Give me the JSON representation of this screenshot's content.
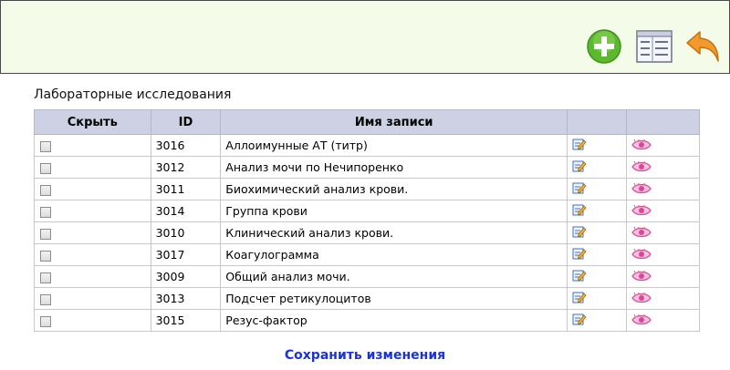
{
  "toolbar": {
    "add_icon": "add-circle-icon",
    "list_icon": "list-view-icon",
    "back_icon": "undo-arrow-icon",
    "colors": {
      "background": "#f5fbe9",
      "add": "#5cb82e",
      "back": "#f29a2e"
    }
  },
  "section": {
    "title": "Лабораторные исследования"
  },
  "table": {
    "columns": {
      "hide": "Скрыть",
      "id": "ID",
      "name": "Имя записи",
      "edit": "",
      "view": ""
    },
    "header_color": "#cdd1e3",
    "rows": [
      {
        "checked": false,
        "id": "3016",
        "name": "Аллоимунные АТ (титр)"
      },
      {
        "checked": false,
        "id": "3012",
        "name": "Анализ мочи по Нечипоренко"
      },
      {
        "checked": false,
        "id": "3011",
        "name": "Биохимический анализ крови."
      },
      {
        "checked": false,
        "id": "3014",
        "name": "Группа крови"
      },
      {
        "checked": false,
        "id": "3010",
        "name": "Клинический анализ крови."
      },
      {
        "checked": false,
        "id": "3017",
        "name": "Коагулограмма"
      },
      {
        "checked": false,
        "id": "3009",
        "name": "Общий анализ мочи."
      },
      {
        "checked": false,
        "id": "3013",
        "name": "Подсчет ретикулоцитов"
      },
      {
        "checked": false,
        "id": "3015",
        "name": "Резус-фактор"
      }
    ],
    "row_icons": {
      "edit": "edit-pencil-icon",
      "view": "eye-icon"
    }
  },
  "actions": {
    "save_label": "Сохранить изменения",
    "link_color": "#1a33d6"
  }
}
